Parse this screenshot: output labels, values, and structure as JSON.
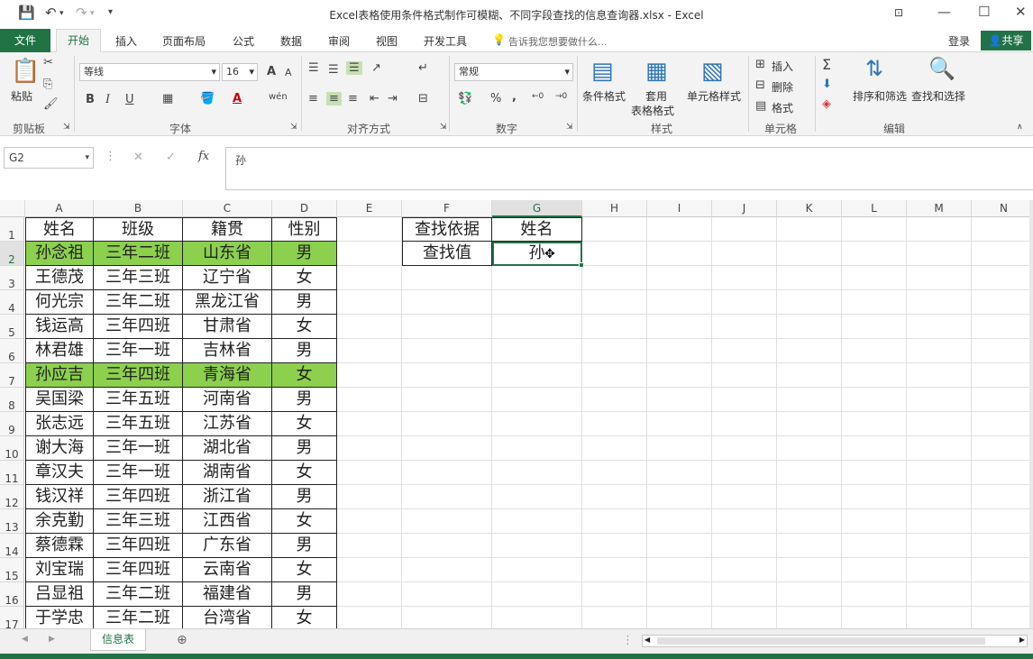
{
  "window": {
    "title": "Excel表格使用条件格式制作可模糊、不同字段查找的信息查询器.xlsx - Excel"
  },
  "tabs": {
    "file": "文件",
    "home": "开始",
    "insert": "插入",
    "layout": "页面布局",
    "formula": "公式",
    "data": "数据",
    "review": "审阅",
    "view": "视图",
    "dev": "开发工具",
    "tellme": "告诉我您想要做什么...",
    "login": "登录",
    "share": "共享"
  },
  "ribbon": {
    "clipboard": {
      "label": "剪贴板",
      "paste": "粘贴"
    },
    "font": {
      "label": "字体",
      "name": "等线",
      "size": "16",
      "bold": "B",
      "italic": "I",
      "underline": "U",
      "grow": "A",
      "shrink": "A",
      "color": "A",
      "wen": "wén"
    },
    "align": {
      "label": "对齐方式"
    },
    "number": {
      "label": "数字",
      "format": "常规",
      "percent": "%",
      "comma": ","
    },
    "styles": {
      "label": "样式",
      "cond": "条件格式",
      "table1": "套用",
      "table2": "表格格式",
      "cell": "单元格样式"
    },
    "cells": {
      "label": "单元格",
      "insert": "插入",
      "delete": "删除",
      "format": "格式"
    },
    "edit": {
      "label": "编辑",
      "sort": "排序和筛选",
      "find": "查找和选择"
    }
  },
  "formula": {
    "namebox": "G2",
    "value": "孙",
    "fx": "fx"
  },
  "grid": {
    "columns": [
      "A",
      "B",
      "C",
      "D",
      "E",
      "F",
      "G",
      "H",
      "I",
      "J",
      "K",
      "L",
      "M",
      "N"
    ],
    "rows": [
      "1",
      "2",
      "3",
      "4",
      "5",
      "6",
      "7",
      "8",
      "9",
      "10",
      "11",
      "12",
      "13",
      "14",
      "15",
      "16",
      "17"
    ],
    "header": [
      "姓名",
      "班级",
      "籍贯",
      "性别"
    ],
    "data": [
      [
        "孙念祖",
        "三年二班",
        "山东省",
        "男"
      ],
      [
        "王德茂",
        "三年三班",
        "辽宁省",
        "女"
      ],
      [
        "何光宗",
        "三年二班",
        "黑龙江省",
        "男"
      ],
      [
        "钱运高",
        "三年四班",
        "甘肃省",
        "女"
      ],
      [
        "林君雄",
        "三年一班",
        "吉林省",
        "男"
      ],
      [
        "孙应吉",
        "三年四班",
        "青海省",
        "女"
      ],
      [
        "吴国梁",
        "三年五班",
        "河南省",
        "男"
      ],
      [
        "张志远",
        "三年五班",
        "江苏省",
        "女"
      ],
      [
        "谢大海",
        "三年一班",
        "湖北省",
        "男"
      ],
      [
        "章汉夫",
        "三年一班",
        "湖南省",
        "女"
      ],
      [
        "钱汉祥",
        "三年四班",
        "浙江省",
        "男"
      ],
      [
        "余克勤",
        "三年三班",
        "江西省",
        "女"
      ],
      [
        "蔡德霖",
        "三年四班",
        "广东省",
        "男"
      ],
      [
        "刘宝瑞",
        "三年四班",
        "云南省",
        "女"
      ],
      [
        "吕显祖",
        "三年二班",
        "福建省",
        "男"
      ],
      [
        "于学忠",
        "三年二班",
        "台湾省",
        "女"
      ]
    ],
    "lookup": {
      "f1": "查找依据",
      "g1": "姓名",
      "f2": "查找值",
      "g2": "孙"
    },
    "highlight_color": "#8cd04e"
  },
  "sheet": {
    "name": "信息表"
  }
}
